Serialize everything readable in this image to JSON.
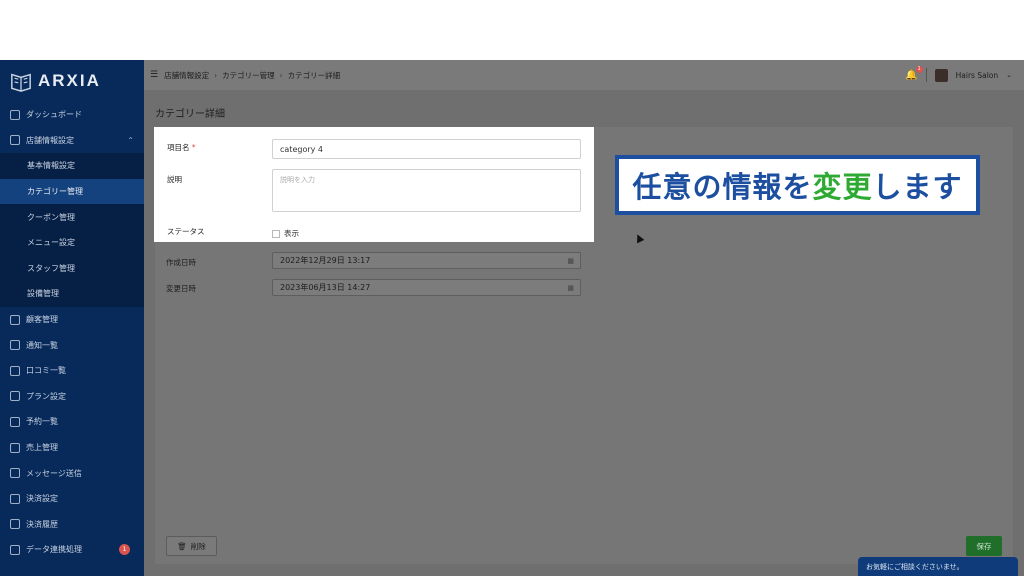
{
  "app": {
    "logo_text": "ARXIA"
  },
  "sidebar": {
    "items": [
      {
        "label": "ダッシュボード"
      },
      {
        "label": "店舗情報設定"
      },
      {
        "label": "顧客管理"
      },
      {
        "label": "通知一覧"
      },
      {
        "label": "口コミ一覧"
      },
      {
        "label": "プラン設定"
      },
      {
        "label": "予約一覧"
      },
      {
        "label": "売上管理"
      },
      {
        "label": "メッセージ送信"
      },
      {
        "label": "決済設定"
      },
      {
        "label": "決済履歴"
      },
      {
        "label": "データ連携処理",
        "badge": "1"
      }
    ],
    "submenu": [
      {
        "label": "基本情報設定"
      },
      {
        "label": "カテゴリー管理"
      },
      {
        "label": "クーポン管理"
      },
      {
        "label": "メニュー設定"
      },
      {
        "label": "スタッフ管理"
      },
      {
        "label": "設備管理"
      }
    ]
  },
  "topbar": {
    "breadcrumb": [
      "店舗情報設定",
      "カテゴリー管理",
      "カテゴリー詳細"
    ],
    "notification_count": "1",
    "user_name": "Hairs Salon"
  },
  "page": {
    "title": "カテゴリー詳細"
  },
  "form": {
    "name_label": "項目名",
    "name_required": "*",
    "name_value": "category 4",
    "desc_label": "説明",
    "desc_placeholder": "説明を入力",
    "status_label": "ステータス",
    "status_checkbox_label": "表示",
    "created_label": "作成日時",
    "created_value": "2022年12月29日 13:17",
    "updated_label": "変更日時",
    "updated_value": "2023年06月13日 14:27"
  },
  "actions": {
    "delete_label": "削除",
    "save_label": "保存"
  },
  "chat": {
    "label": "お気軽にご相談くださいませ。"
  },
  "annotation": {
    "text_a": "任意の情報を",
    "text_b": "変更",
    "text_c": "します"
  },
  "colors": {
    "sidebar_bg": "#082a5a",
    "save_green": "#1f6e2a",
    "annotation_blue": "#1d4fa0",
    "annotation_green": "#2eaa33"
  }
}
